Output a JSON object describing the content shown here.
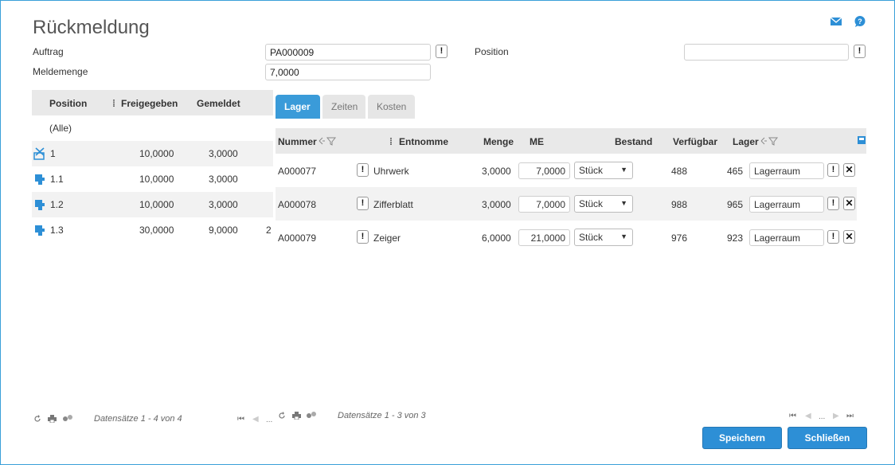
{
  "header": {
    "title": "Rückmeldung",
    "icons": [
      "mail-icon",
      "help-icon"
    ]
  },
  "form": {
    "auftrag_label": "Auftrag",
    "auftrag_value": "PA000009",
    "meldemenge_label": "Meldemenge",
    "meldemenge_value": "7,0000",
    "position_label": "Position",
    "position_value": "",
    "excl_glyph": "!"
  },
  "left_grid": {
    "columns": [
      "Position",
      "Freigegeben",
      "Gemeldet"
    ],
    "all_label": "(Alle)",
    "rows": [
      {
        "position": "1",
        "freigegeben": "10,0000",
        "gemeldet": "3,0000",
        "extra": "",
        "icon": "scissors-icon"
      },
      {
        "position": "1.1",
        "freigegeben": "10,0000",
        "gemeldet": "3,0000",
        "extra": "",
        "icon": "puzzle-icon"
      },
      {
        "position": "1.2",
        "freigegeben": "10,0000",
        "gemeldet": "3,0000",
        "extra": "",
        "icon": "puzzle-icon"
      },
      {
        "position": "1.3",
        "freigegeben": "30,0000",
        "gemeldet": "9,0000",
        "extra": "2",
        "icon": "puzzle-icon"
      }
    ],
    "footer_text": "Datensätze 1 - 4 von 4",
    "pager_dots": "..."
  },
  "tabs": [
    {
      "label": "Lager",
      "active": true
    },
    {
      "label": "Zeiten",
      "active": false
    },
    {
      "label": "Kosten",
      "active": false
    }
  ],
  "right_grid": {
    "columns": {
      "nummer": "Nummer",
      "entnomme": "Entnomme",
      "menge": "Menge",
      "me": "ME",
      "bestand": "Bestand",
      "verfuegbar": "Verfügbar",
      "lager": "Lager"
    },
    "rows": [
      {
        "nummer": "A000077",
        "entnomme": "Uhrwerk",
        "menge": "3,0000",
        "me_value": "7,0000",
        "unit": "Stück",
        "bestand": "488",
        "verfuegbar": "465",
        "lager": "Lagerraum"
      },
      {
        "nummer": "A000078",
        "entnomme": "Zifferblatt",
        "menge": "3,0000",
        "me_value": "7,0000",
        "unit": "Stück",
        "bestand": "988",
        "verfuegbar": "965",
        "lager": "Lagerraum"
      },
      {
        "nummer": "A000079",
        "entnomme": "Zeiger",
        "menge": "6,0000",
        "me_value": "21,0000",
        "unit": "Stück",
        "bestand": "976",
        "verfuegbar": "923",
        "lager": "Lagerraum"
      }
    ],
    "footer_text": "Datensätze 1 - 3 von 3",
    "pager_dots": "..."
  },
  "buttons": {
    "save": "Speichern",
    "close": "Schließen"
  },
  "colors": {
    "accent": "#3a9bd9",
    "button": "#2d8fd6",
    "header_bg": "#e9e9e9"
  }
}
